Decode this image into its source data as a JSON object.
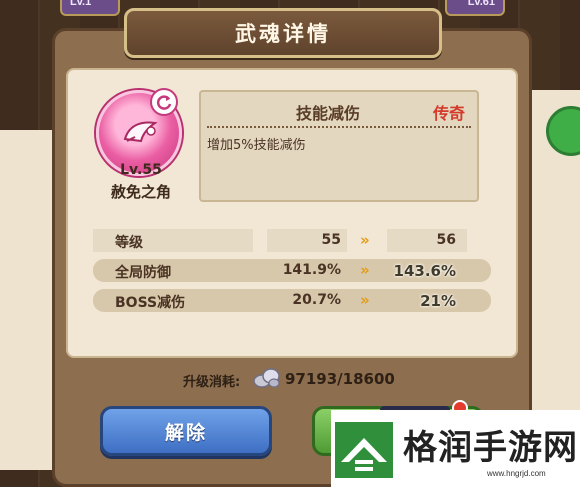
{
  "background": {
    "tab_left_level": "Lv.1",
    "tab_right_level": "Lv.61"
  },
  "dialog": {
    "title": "武魂详情",
    "item": {
      "level": "Lv.55",
      "name": "赦免之角",
      "icon": "pink-horn-icon"
    },
    "skill": {
      "name": "技能减伤",
      "rarity": "传奇",
      "description": "增加5%技能减伤"
    },
    "stats": [
      {
        "label": "等级",
        "old": "55",
        "new": "56"
      },
      {
        "label": "全局防御",
        "old": "141.9%",
        "new": "143.6%"
      },
      {
        "label": "BOSS减伤",
        "old": "20.7%",
        "new": "21%"
      }
    ],
    "arrow_glyph": "»",
    "cost": {
      "label": "升级消耗:",
      "value": "97193/18600",
      "icon": "soul-gem-icon"
    },
    "buttons": {
      "remove_label": "解除"
    }
  },
  "watermark": {
    "title": "格润手游网",
    "url": "www.hngrjd.com"
  },
  "colors": {
    "rarity_legendary": "#d43a2a",
    "arrow": "#e59b15",
    "button_blue": "#3e6fc4",
    "button_green": "#4f9b34"
  }
}
